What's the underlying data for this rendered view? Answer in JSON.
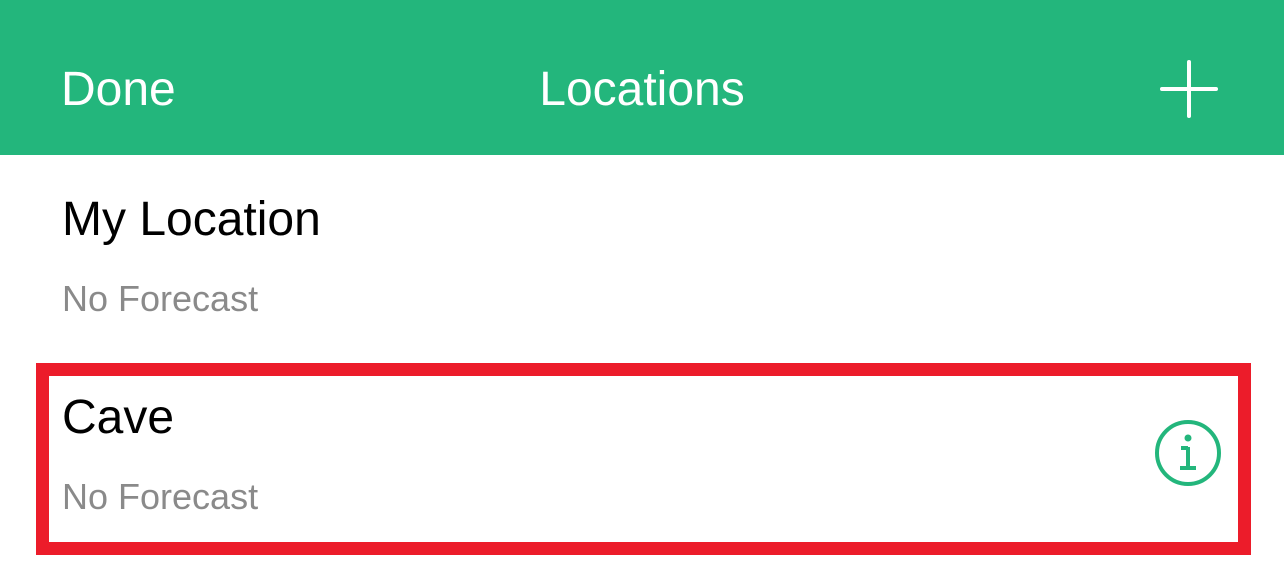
{
  "navbar": {
    "done_label": "Done",
    "title": "Locations",
    "add_icon": "plus-icon",
    "background_color": "#23b67c"
  },
  "locations": [
    {
      "name": "My Location",
      "status": "No Forecast"
    },
    {
      "name": "Cave",
      "status": "No Forecast",
      "info_icon": "info-circle-icon"
    }
  ],
  "colors": {
    "accent": "#23b67c",
    "highlight": "#ec1c2a",
    "secondary_text": "#8a8a8a"
  }
}
